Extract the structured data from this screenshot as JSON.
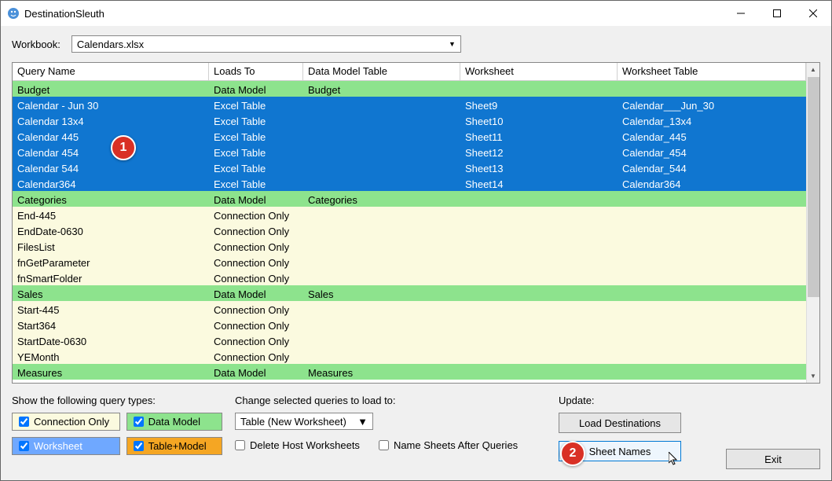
{
  "title": "DestinationSleuth",
  "workbook_label": "Workbook:",
  "workbook_value": "Calendars.xlsx",
  "columns": [
    "Query Name",
    "Loads To",
    "Data Model Table",
    "Worksheet",
    "Worksheet Table"
  ],
  "rows": [
    {
      "k": "green",
      "c": [
        "Budget",
        "Data Model",
        "Budget",
        "",
        ""
      ]
    },
    {
      "k": "blue",
      "c": [
        "Calendar - Jun 30",
        "Excel Table",
        "",
        "Sheet9",
        "Calendar___Jun_30"
      ]
    },
    {
      "k": "blue",
      "c": [
        "Calendar 13x4",
        "Excel Table",
        "",
        "Sheet10",
        "Calendar_13x4"
      ]
    },
    {
      "k": "blue",
      "c": [
        "Calendar 445",
        "Excel Table",
        "",
        "Sheet11",
        "Calendar_445"
      ]
    },
    {
      "k": "blue",
      "c": [
        "Calendar 454",
        "Excel Table",
        "",
        "Sheet12",
        "Calendar_454"
      ]
    },
    {
      "k": "blue",
      "c": [
        "Calendar 544",
        "Excel Table",
        "",
        "Sheet13",
        "Calendar_544"
      ]
    },
    {
      "k": "blue",
      "c": [
        "Calendar364",
        "Excel Table",
        "",
        "Sheet14",
        "Calendar364"
      ]
    },
    {
      "k": "green",
      "c": [
        "Categories",
        "Data Model",
        "Categories",
        "",
        ""
      ]
    },
    {
      "k": "yellow",
      "c": [
        "End-445",
        "Connection Only",
        "",
        "",
        ""
      ]
    },
    {
      "k": "yellow",
      "c": [
        "EndDate-0630",
        "Connection Only",
        "",
        "",
        ""
      ]
    },
    {
      "k": "yellow",
      "c": [
        "FilesList",
        "Connection Only",
        "",
        "",
        ""
      ]
    },
    {
      "k": "yellow",
      "c": [
        "fnGetParameter",
        "Connection Only",
        "",
        "",
        ""
      ]
    },
    {
      "k": "yellow",
      "c": [
        "fnSmartFolder",
        "Connection Only",
        "",
        "",
        ""
      ]
    },
    {
      "k": "green",
      "c": [
        "Sales",
        "Data Model",
        "Sales",
        "",
        ""
      ]
    },
    {
      "k": "yellow",
      "c": [
        "Start-445",
        "Connection Only",
        "",
        "",
        ""
      ]
    },
    {
      "k": "yellow",
      "c": [
        "Start364",
        "Connection Only",
        "",
        "",
        ""
      ]
    },
    {
      "k": "yellow",
      "c": [
        "StartDate-0630",
        "Connection Only",
        "",
        "",
        ""
      ]
    },
    {
      "k": "yellow",
      "c": [
        "YEMonth",
        "Connection Only",
        "",
        "",
        ""
      ]
    },
    {
      "k": "green",
      "c": [
        "Measures",
        "Data Model",
        "Measures",
        "",
        ""
      ]
    }
  ],
  "show_label": "Show the following query types:",
  "chk_co": "Connection Only",
  "chk_dm": "Data Model",
  "chk_ws": "Worksheet",
  "chk_tm": "Table+Model",
  "change_label": "Change selected queries to load to:",
  "change_combo": "Table (New Worksheet)",
  "chk_delete": "Delete Host Worksheets",
  "chk_name": "Name Sheets After Queries",
  "update_label": "Update:",
  "btn_load": "Load Destinations",
  "btn_sheet": "Sheet Names",
  "btn_exit": "Exit",
  "marker1": "1",
  "marker2": "2"
}
